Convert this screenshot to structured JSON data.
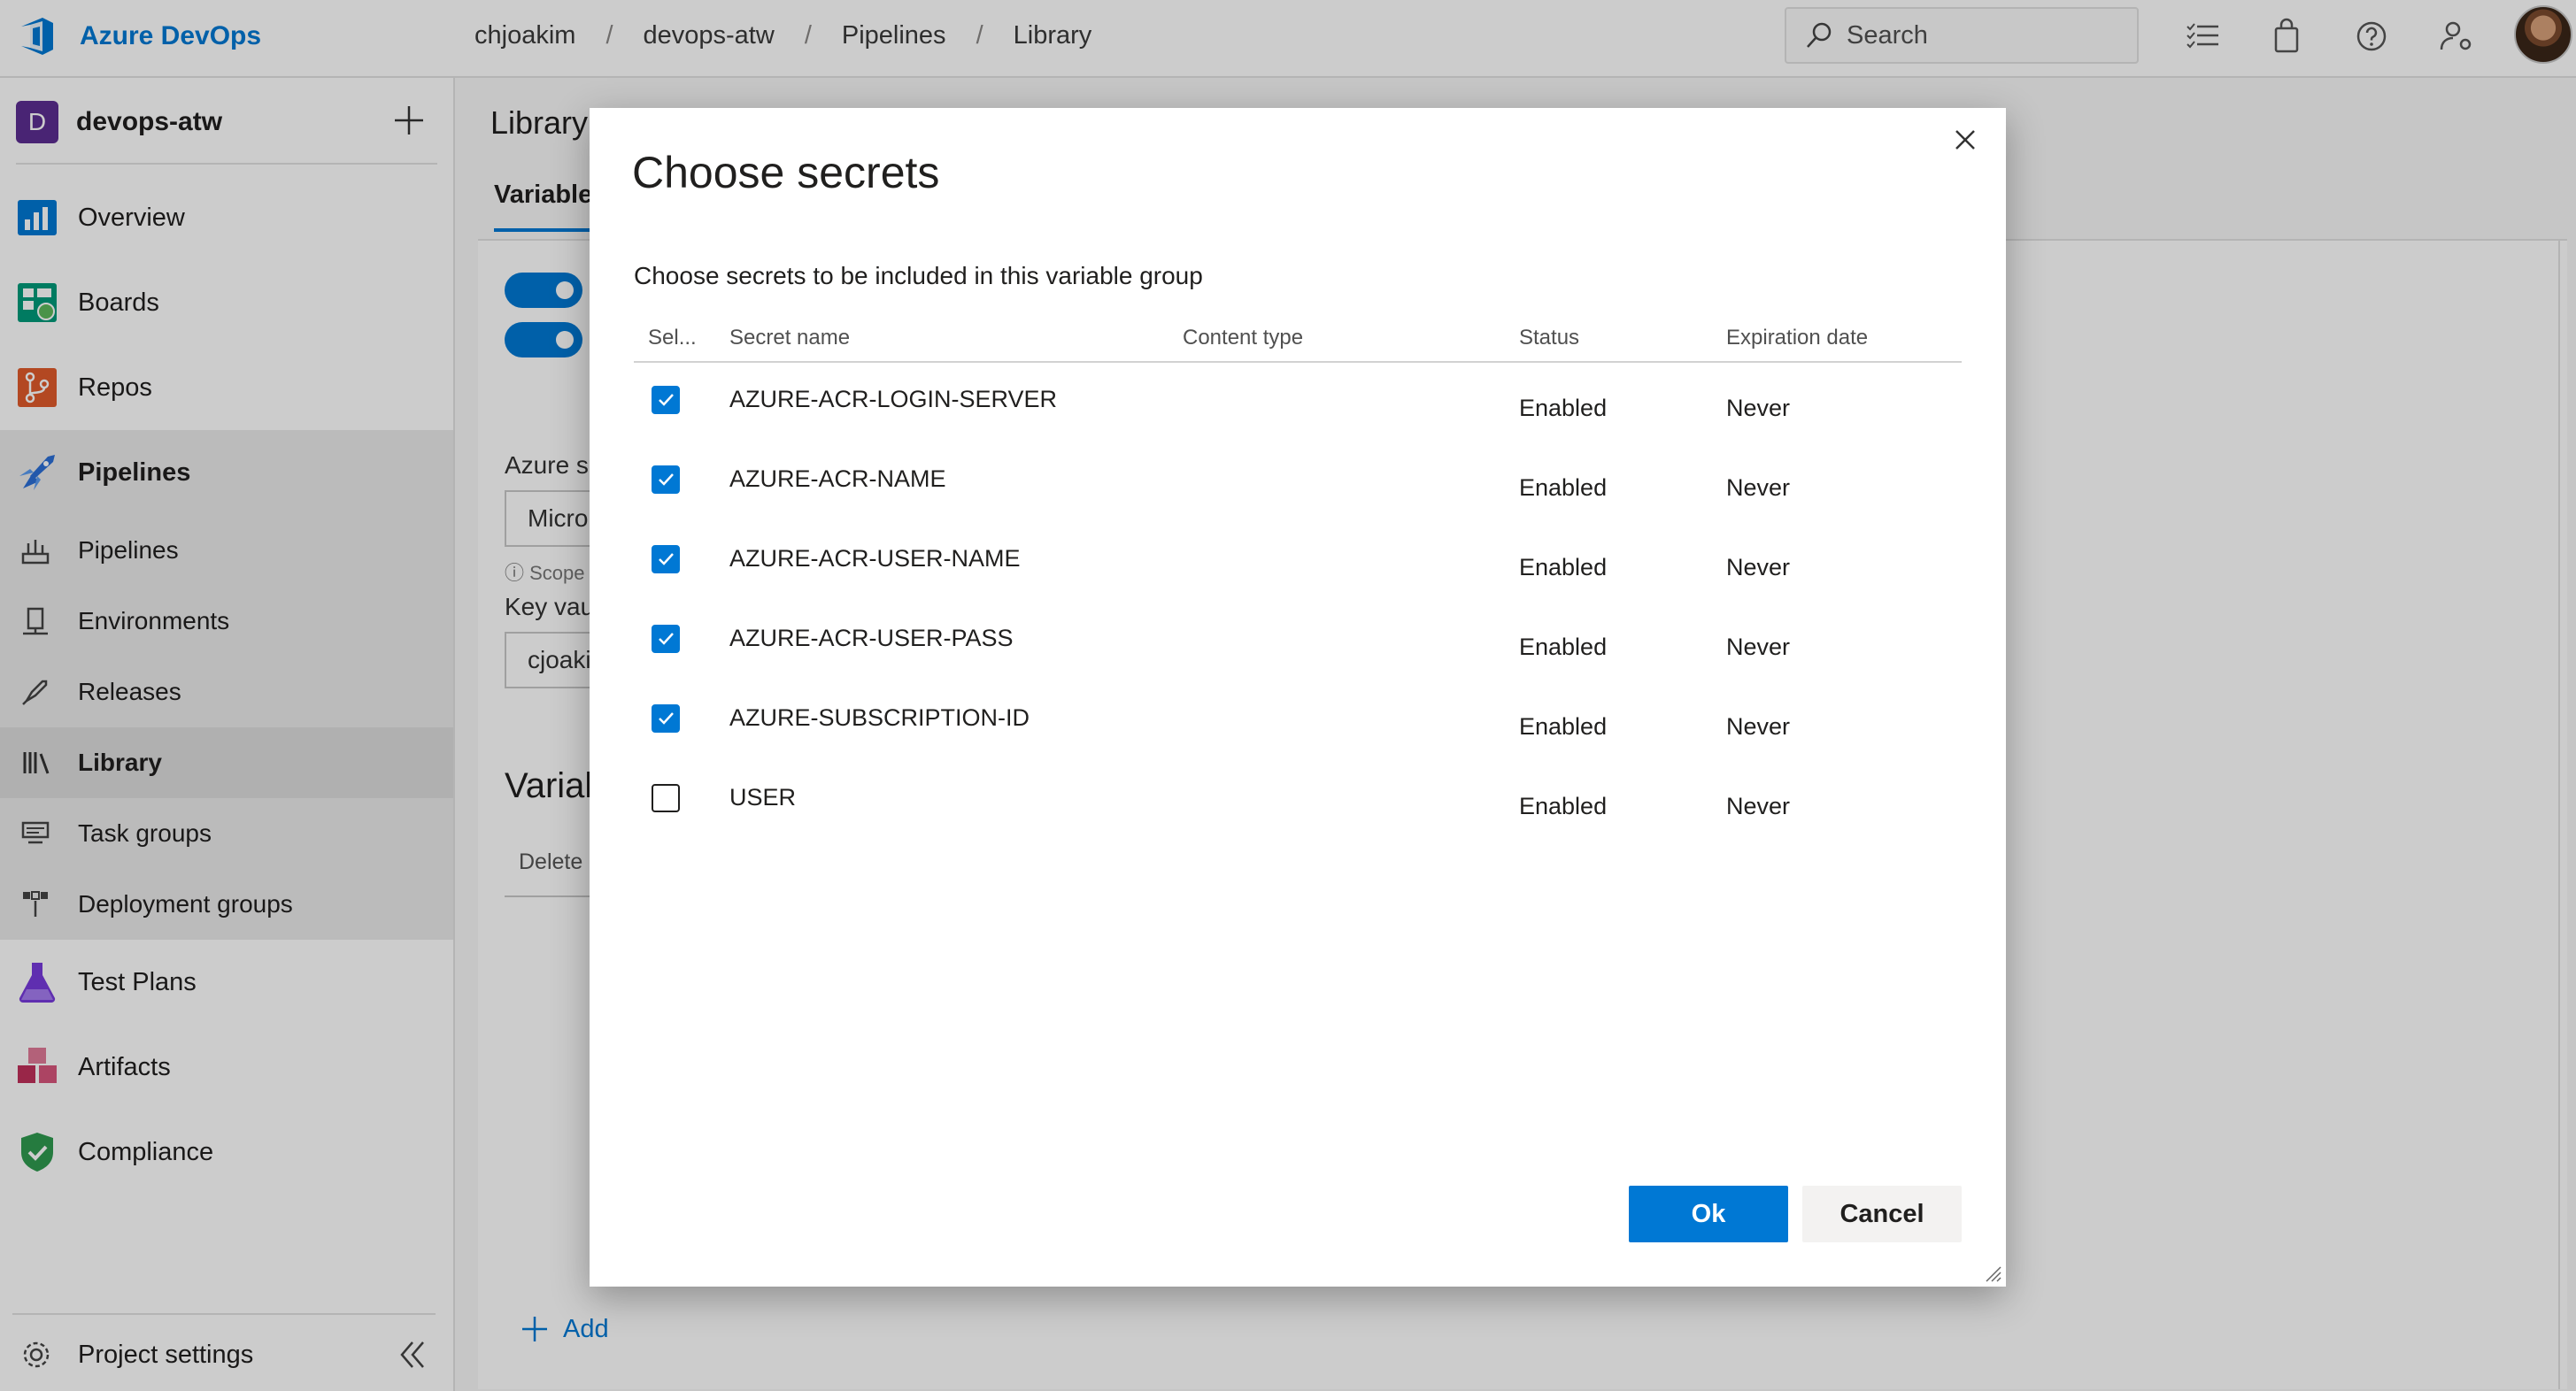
{
  "app": {
    "name": "Azure DevOps"
  },
  "breadcrumb": [
    "chjoakim",
    "devops-atw",
    "Pipelines",
    "Library"
  ],
  "search": {
    "placeholder": "Search"
  },
  "sidebar": {
    "project": {
      "initial": "D",
      "name": "devops-atw"
    },
    "items": [
      {
        "label": "Overview",
        "icon": "overview-icon",
        "color": "#0078d4"
      },
      {
        "label": "Boards",
        "icon": "boards-icon",
        "color": "#009a7a"
      },
      {
        "label": "Repos",
        "icon": "repos-icon",
        "color": "#e05a2b"
      },
      {
        "label": "Pipelines",
        "icon": "pipelines-icon",
        "color": "#2b6fd6"
      },
      {
        "label": "Pipelines",
        "icon": "pipelines-sub-icon"
      },
      {
        "label": "Environments",
        "icon": "environments-icon"
      },
      {
        "label": "Releases",
        "icon": "releases-icon"
      },
      {
        "label": "Library",
        "icon": "library-icon"
      },
      {
        "label": "Task groups",
        "icon": "task-groups-icon"
      },
      {
        "label": "Deployment groups",
        "icon": "deployment-groups-icon"
      },
      {
        "label": "Test Plans",
        "icon": "test-plans-icon",
        "color": "#773adc"
      },
      {
        "label": "Artifacts",
        "icon": "artifacts-icon",
        "color": "#c0305a"
      },
      {
        "label": "Compliance",
        "icon": "compliance-icon",
        "color": "#2f9a4f"
      }
    ],
    "settings_label": "Project settings"
  },
  "main": {
    "title": "Library",
    "tab": "Variable",
    "azure_label": "Azure su",
    "azure_value": "Micro",
    "scope_note": "Scope",
    "keyvault_label": "Key vau",
    "keyvault_value": "cjoakir",
    "variables_heading": "Varial",
    "delete_label": "Delete",
    "add_label": "Add"
  },
  "dialog": {
    "title": "Choose secrets",
    "subtitle": "Choose secrets to be included in this variable group",
    "columns": [
      "Sel...",
      "Secret name",
      "Content type",
      "Status",
      "Expiration date"
    ],
    "rows": [
      {
        "checked": true,
        "name": "AZURE-ACR-LOGIN-SERVER",
        "content_type": "",
        "status": "Enabled",
        "expiration": "Never"
      },
      {
        "checked": true,
        "name": "AZURE-ACR-NAME",
        "content_type": "",
        "status": "Enabled",
        "expiration": "Never"
      },
      {
        "checked": true,
        "name": "AZURE-ACR-USER-NAME",
        "content_type": "",
        "status": "Enabled",
        "expiration": "Never"
      },
      {
        "checked": true,
        "name": "AZURE-ACR-USER-PASS",
        "content_type": "",
        "status": "Enabled",
        "expiration": "Never"
      },
      {
        "checked": true,
        "name": "AZURE-SUBSCRIPTION-ID",
        "content_type": "",
        "status": "Enabled",
        "expiration": "Never"
      },
      {
        "checked": false,
        "name": "USER",
        "content_type": "",
        "status": "Enabled",
        "expiration": "Never"
      }
    ],
    "ok_label": "Ok",
    "cancel_label": "Cancel"
  },
  "colors": {
    "accent": "#0078d4",
    "project_badge": "#5c2d91"
  }
}
